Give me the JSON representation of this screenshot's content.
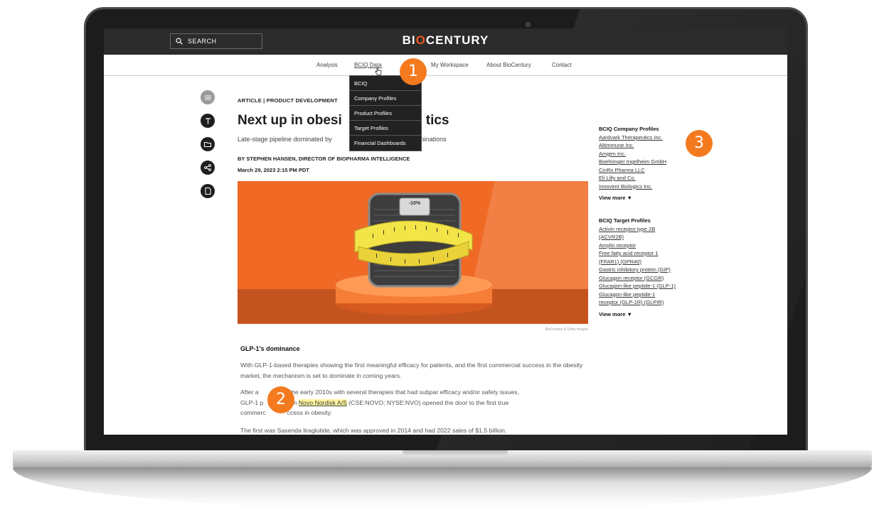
{
  "site": {
    "logo_left": "BI",
    "logo_mid": "O",
    "logo_right": "CENTURY"
  },
  "search": {
    "label": "SEARCH"
  },
  "nav": {
    "analysis": "Analysis",
    "bciq_data": "BCIQ Data",
    "my_workspace": "My Workspace",
    "about": "About BioCentury",
    "contact": "Contact"
  },
  "dropdown": {
    "items": [
      "BCIQ",
      "Company Profiles",
      "Product Profiles",
      "Target Profiles",
      "Financial Dashboards"
    ]
  },
  "badges": {
    "one": "1",
    "two": "2",
    "three": "3"
  },
  "article": {
    "kicker": "ARTICLE | PRODUCT DEVELOPMENT",
    "headline_a": "Next up in obesi",
    "headline_b": "tics",
    "subhead_a": "Late-stage pipeline dominated by",
    "subhead_b": "combinations",
    "byline": "BY STEPHEN HANSEN, DIRECTOR OF BIOPHARMA INTELLIGENCE",
    "date": "March 29, 2023 2:15 PM PDT",
    "image_credit": "BioCentury & Getty Images",
    "scale_readout": "-10%",
    "section_title": "GLP-1's dominance",
    "p1": "With GLP-1-based therapies showing the first meaningful efficacy for patients, and the first commercial success in the obesity market, the mechanism is set to dominate in coming years.",
    "p2_a": "After a",
    "p2_b": "t in the early 2010s with several therapies that had subpar efficacy and/or safety issues,",
    "p2_c": "GLP-1 p",
    "p2_d": "rom",
    "p2_link": "Novo Nordisk A/S",
    "p2_e": "(CSE:NOVO; NYSE:NVO) opened the door to the first true",
    "p2_f": "commerc",
    "p2_g": "ccess in obesity.",
    "p3": "The first was Saxenda liraglutide, which was approved in 2014 and had 2022 sales of $1.5 billion."
  },
  "company_profiles": {
    "title": "BCIQ Company Profiles",
    "items": [
      "Aardvark Therapeutics Inc.",
      "Altimmune Inc.",
      "Amgen Inc.",
      "Boehringer Ingelheim GmbH",
      "CinRx Pharma LLC",
      "Eli Lilly and Co.",
      "Innovent Biologics Inc."
    ],
    "more": "View more ▼"
  },
  "target_profiles": {
    "title": "BCIQ Target Profiles",
    "items": [
      "Activin receptor type 2B",
      "(ACVR2B)",
      "Amylin receptor",
      "Free fatty acid receptor 1",
      "(FFAR1) (GPR40)",
      "Gastric inhibitory protein (GIP)",
      "Glucagon receptor (GCGR)",
      "Glucagon-like peptide-1 (GLP-1)",
      "Glucagon-like peptide-1",
      "receptor (GLP-1R) (GLPIR)"
    ],
    "more": "View more ▼"
  },
  "colors": {
    "accent": "#f15a22",
    "badge": "#f47a1f",
    "highlight": "#fff59d"
  }
}
